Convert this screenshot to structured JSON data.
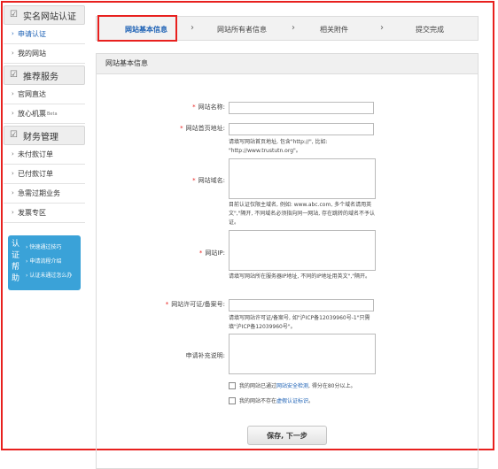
{
  "sidebar": {
    "sections": [
      {
        "title": "实名网站认证",
        "items": [
          "申请认证",
          "我的网站"
        ]
      },
      {
        "title": "推荐服务",
        "items": [
          "官网直达",
          "放心机票"
        ]
      },
      {
        "title": "财务管理",
        "items": [
          "未付款订单",
          "已付款订单",
          "急需过期业务",
          "发票专区"
        ]
      }
    ],
    "beta_badge": "Beta",
    "help": {
      "title": "认证帮助",
      "links": [
        "快速通过技巧",
        "申请流程介绍",
        "认证未通过怎么办"
      ]
    }
  },
  "steps": [
    "网站基本信息",
    "网站所有者信息",
    "相关附件",
    "提交完成"
  ],
  "panel_title": "网站基本信息",
  "form": {
    "site_name_label": "网站名称:",
    "homepage_label": "网站首页地址:",
    "homepage_hint": "请填写网站首页地址, 包含\"http://\", 比如: \"http://www.trustutn.org\"。",
    "domain_label": "网站域名:",
    "domain_hint": "目前认证仅限主域名, 例如: www.abc.com, 多个域名请用英文\",\"隔开, 不同域名必须指向同一网站, 存在跳转的域名不予认证。",
    "ip_label": "网站IP:",
    "ip_hint": "请填写网站所在服务器IP地址, 不同的IP地址用英文\",\"隔开。",
    "icp_label": "网站许可证/备案号:",
    "icp_hint": "请填写网站许可证/备案号, 如\"沪ICP备12039960号-1\"只需填\"沪ICP备12039960号\"。",
    "notes_label": "申请补充说明:",
    "check1_prefix": "我的网站已通过",
    "check1_link": "网站安全检测",
    "check1_suffix": ", 得分在80分以上。",
    "check2_prefix": "我的网站不存在",
    "check2_link": "虚假认证标识",
    "check2_suffix": "。",
    "submit_label": "保存, 下一步"
  }
}
